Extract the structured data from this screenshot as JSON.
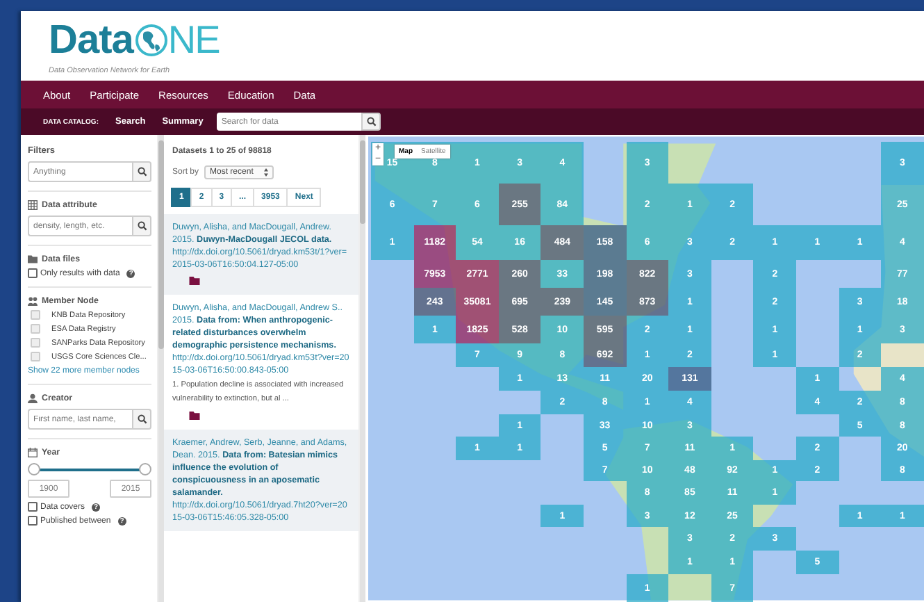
{
  "logo": {
    "word": "Data",
    "tail": "NE",
    "tagline": "Data Observation Network for Earth"
  },
  "nav": [
    "About",
    "Participate",
    "Resources",
    "Education",
    "Data"
  ],
  "catalog_bar": {
    "label": "DATA CATALOG:",
    "links": [
      "Search",
      "Summary"
    ],
    "search": {
      "placeholder": "Search for data"
    }
  },
  "filters": {
    "title": "Filters",
    "search": {
      "placeholder": "Anything"
    },
    "sections": [
      {
        "kind": "field",
        "title": "Data attribute",
        "placeholder": "density, length, etc."
      },
      {
        "kind": "checks",
        "title": "Data files",
        "items": [
          {
            "label": "Only results with data",
            "checked": false,
            "help": "?"
          }
        ]
      },
      {
        "kind": "checks",
        "title": "Member Node",
        "items": [
          {
            "label": "KNB Data Repository",
            "checked": false
          },
          {
            "label": "ESA Data Registry",
            "checked": false
          },
          {
            "label": "SANParks Data Repository",
            "checked": false
          },
          {
            "label": "USGS Core Sciences Cle...",
            "checked": false
          }
        ],
        "more": "Show 22 more member nodes"
      },
      {
        "kind": "field",
        "title": "Creator",
        "placeholder": "First name, last name,"
      },
      {
        "kind": "range",
        "title": "Year",
        "handles": [
          {
            "level": 0
          },
          {
            "level": 1
          }
        ],
        "low": "1900",
        "high": "2015",
        "items": [
          {
            "label": "Data covers",
            "checked": false,
            "help": "?"
          },
          {
            "label": "Published between",
            "checked": false,
            "help": "?"
          }
        ]
      }
    ]
  },
  "results": {
    "summary": "Datasets 1 to 25 of 98818",
    "sort": {
      "label": "Sort by",
      "value": "Most recent"
    },
    "pages": [
      {
        "label": "1",
        "selected": true
      },
      {
        "label": "2",
        "selected": false
      },
      {
        "label": "3",
        "selected": false
      },
      {
        "label": "...",
        "selected": false
      },
      {
        "label": "3953",
        "selected": false
      },
      {
        "label": "Next",
        "selected": false
      }
    ],
    "items": [
      {
        "citation": "Duwyn, Alisha, and MacDougall, Andrew. 2015. **Duwyn-MacDougall JECOL data.**",
        "url": "http://dx.doi.org/10.5061/dryad.km53t/1?ver=2015-03-06T16:50:04.127-05:00",
        "files": true
      },
      {
        "citation": "Duwyn, Alisha, and MacDougall, Andrew S.. 2015. **Data from: When anthropogenic-related disturbances overwhelm demographic persistence mechanisms.**",
        "url": "http://dx.doi.org/10.5061/dryad.km53t?ver=2015-03-06T16:50:00.843-05:00",
        "abstract": "1. Population decline is associated with increased vulnerability to extinction, but al ...",
        "files": true
      },
      {
        "citation": "Kraemer, Andrew, Serb, Jeanne, and Adams, Dean. 2015. **Data from: Batesian mimics influence the evolution of conspicuousness in an aposematic salamander.**",
        "url": "http://dx.doi.org/10.5061/dryad.7ht20?ver=2015-03-06T15:46:05.328-05:00",
        "files": false
      }
    ]
  },
  "map": {
    "zoom": {
      "in": "+",
      "out": "−"
    },
    "types": [
      {
        "label": "Map",
        "selected": true
      },
      {
        "label": "Satellite",
        "selected": false
      }
    ],
    "grid": [
      [
        {
          "kind": "count",
          "label": "15"
        },
        {
          "kind": "count",
          "label": "8"
        },
        {
          "kind": "count",
          "label": "1"
        },
        {
          "kind": "count",
          "label": "3"
        },
        {
          "kind": "count",
          "label": "4"
        },
        {
          "kind": "empty"
        },
        {
          "kind": "count",
          "label": "3"
        },
        {
          "kind": "empty"
        },
        {
          "kind": "empty"
        },
        {
          "kind": "empty"
        },
        {
          "kind": "empty"
        },
        {
          "kind": "empty"
        },
        {
          "kind": "count",
          "label": "3"
        }
      ],
      [
        {
          "kind": "count",
          "label": "6"
        },
        {
          "kind": "count",
          "label": "7"
        },
        {
          "kind": "count",
          "label": "6"
        },
        {
          "kind": "count",
          "label": "255"
        },
        {
          "kind": "count",
          "label": "84"
        },
        {
          "kind": "empty"
        },
        {
          "kind": "count",
          "label": "2"
        },
        {
          "kind": "count",
          "label": "1"
        },
        {
          "kind": "count",
          "label": "2"
        },
        {
          "kind": "empty"
        },
        {
          "kind": "empty"
        },
        {
          "kind": "empty"
        },
        {
          "kind": "count",
          "label": "25"
        }
      ],
      [
        {
          "kind": "count",
          "label": "1"
        },
        {
          "kind": "count",
          "label": "1182"
        },
        {
          "kind": "count",
          "label": "54"
        },
        {
          "kind": "count",
          "label": "16"
        },
        {
          "kind": "count",
          "label": "484"
        },
        {
          "kind": "count",
          "label": "158"
        },
        {
          "kind": "count",
          "label": "6"
        },
        {
          "kind": "count",
          "label": "3"
        },
        {
          "kind": "count",
          "label": "2"
        },
        {
          "kind": "count",
          "label": "1"
        },
        {
          "kind": "count",
          "label": "1"
        },
        {
          "kind": "count",
          "label": "1"
        },
        {
          "kind": "count",
          "label": "4"
        }
      ],
      [
        {
          "kind": "empty"
        },
        {
          "kind": "count",
          "label": "7953"
        },
        {
          "kind": "count",
          "label": "2771"
        },
        {
          "kind": "count",
          "label": "260"
        },
        {
          "kind": "count",
          "label": "33"
        },
        {
          "kind": "count",
          "label": "198"
        },
        {
          "kind": "count",
          "label": "822"
        },
        {
          "kind": "count",
          "label": "3"
        },
        {
          "kind": "empty"
        },
        {
          "kind": "count",
          "label": "2"
        },
        {
          "kind": "empty"
        },
        {
          "kind": "empty"
        },
        {
          "kind": "count",
          "label": "77"
        }
      ],
      [
        {
          "kind": "empty"
        },
        {
          "kind": "count",
          "label": "243"
        },
        {
          "kind": "count",
          "label": "35081"
        },
        {
          "kind": "count",
          "label": "695"
        },
        {
          "kind": "count",
          "label": "239"
        },
        {
          "kind": "count",
          "label": "145"
        },
        {
          "kind": "count",
          "label": "873"
        },
        {
          "kind": "count",
          "label": "1"
        },
        {
          "kind": "empty"
        },
        {
          "kind": "count",
          "label": "2"
        },
        {
          "kind": "empty"
        },
        {
          "kind": "count",
          "label": "3"
        },
        {
          "kind": "count",
          "label": "18"
        }
      ],
      [
        {
          "kind": "empty"
        },
        {
          "kind": "count",
          "label": "1"
        },
        {
          "kind": "count",
          "label": "1825"
        },
        {
          "kind": "count",
          "label": "528"
        },
        {
          "kind": "count",
          "label": "10"
        },
        {
          "kind": "count",
          "label": "595"
        },
        {
          "kind": "count",
          "label": "2"
        },
        {
          "kind": "count",
          "label": "1"
        },
        {
          "kind": "empty"
        },
        {
          "kind": "count",
          "label": "1"
        },
        {
          "kind": "empty"
        },
        {
          "kind": "count",
          "label": "1"
        },
        {
          "kind": "count",
          "label": "3"
        }
      ],
      [
        {
          "kind": "empty"
        },
        {
          "kind": "empty"
        },
        {
          "kind": "count",
          "label": "7"
        },
        {
          "kind": "count",
          "label": "9"
        },
        {
          "kind": "count",
          "label": "8"
        },
        {
          "kind": "count",
          "label": "692"
        },
        {
          "kind": "count",
          "label": "1"
        },
        {
          "kind": "count",
          "label": "2"
        },
        {
          "kind": "empty"
        },
        {
          "kind": "count",
          "label": "1"
        },
        {
          "kind": "empty"
        },
        {
          "kind": "count",
          "label": "2"
        },
        {
          "kind": "empty"
        }
      ],
      [
        {
          "kind": "empty"
        },
        {
          "kind": "empty"
        },
        {
          "kind": "empty"
        },
        {
          "kind": "count",
          "label": "1"
        },
        {
          "kind": "count",
          "label": "13"
        },
        {
          "kind": "count",
          "label": "11"
        },
        {
          "kind": "count",
          "label": "20"
        },
        {
          "kind": "count",
          "label": "131"
        },
        {
          "kind": "empty"
        },
        {
          "kind": "empty"
        },
        {
          "kind": "count",
          "label": "1"
        },
        {
          "kind": "empty"
        },
        {
          "kind": "count",
          "label": "4"
        }
      ],
      [
        {
          "kind": "empty"
        },
        {
          "kind": "empty"
        },
        {
          "kind": "empty"
        },
        {
          "kind": "empty"
        },
        {
          "kind": "count",
          "label": "2"
        },
        {
          "kind": "count",
          "label": "8"
        },
        {
          "kind": "count",
          "label": "1"
        },
        {
          "kind": "count",
          "label": "4"
        },
        {
          "kind": "empty"
        },
        {
          "kind": "empty"
        },
        {
          "kind": "count",
          "label": "4"
        },
        {
          "kind": "count",
          "label": "2"
        },
        {
          "kind": "count",
          "label": "8"
        }
      ],
      [
        {
          "kind": "empty"
        },
        {
          "kind": "empty"
        },
        {
          "kind": "empty"
        },
        {
          "kind": "count",
          "label": "1"
        },
        {
          "kind": "empty"
        },
        {
          "kind": "count",
          "label": "33"
        },
        {
          "kind": "count",
          "label": "10"
        },
        {
          "kind": "count",
          "label": "3"
        },
        {
          "kind": "empty"
        },
        {
          "kind": "empty"
        },
        {
          "kind": "empty"
        },
        {
          "kind": "count",
          "label": "5"
        },
        {
          "kind": "count",
          "label": "8"
        }
      ],
      [
        {
          "kind": "empty"
        },
        {
          "kind": "empty"
        },
        {
          "kind": "count",
          "label": "1"
        },
        {
          "kind": "count",
          "label": "1"
        },
        {
          "kind": "empty"
        },
        {
          "kind": "count",
          "label": "5"
        },
        {
          "kind": "count",
          "label": "7"
        },
        {
          "kind": "count",
          "label": "11"
        },
        {
          "kind": "count",
          "label": "1"
        },
        {
          "kind": "empty"
        },
        {
          "kind": "count",
          "label": "2"
        },
        {
          "kind": "empty"
        },
        {
          "kind": "count",
          "label": "20"
        }
      ],
      [
        {
          "kind": "empty"
        },
        {
          "kind": "empty"
        },
        {
          "kind": "empty"
        },
        {
          "kind": "empty"
        },
        {
          "kind": "empty"
        },
        {
          "kind": "count",
          "label": "7"
        },
        {
          "kind": "count",
          "label": "10"
        },
        {
          "kind": "count",
          "label": "48"
        },
        {
          "kind": "count",
          "label": "92"
        },
        {
          "kind": "count",
          "label": "1"
        },
        {
          "kind": "count",
          "label": "2"
        },
        {
          "kind": "empty"
        },
        {
          "kind": "count",
          "label": "8"
        }
      ],
      [
        {
          "kind": "empty"
        },
        {
          "kind": "empty"
        },
        {
          "kind": "empty"
        },
        {
          "kind": "empty"
        },
        {
          "kind": "empty"
        },
        {
          "kind": "empty"
        },
        {
          "kind": "count",
          "label": "8"
        },
        {
          "kind": "count",
          "label": "85"
        },
        {
          "kind": "count",
          "label": "11"
        },
        {
          "kind": "count",
          "label": "1"
        },
        {
          "kind": "empty"
        },
        {
          "kind": "empty"
        },
        {
          "kind": "empty"
        }
      ],
      [
        {
          "kind": "empty"
        },
        {
          "kind": "empty"
        },
        {
          "kind": "empty"
        },
        {
          "kind": "empty"
        },
        {
          "kind": "count",
          "label": "1"
        },
        {
          "kind": "empty"
        },
        {
          "kind": "count",
          "label": "3"
        },
        {
          "kind": "count",
          "label": "12"
        },
        {
          "kind": "count",
          "label": "25"
        },
        {
          "kind": "empty"
        },
        {
          "kind": "empty"
        },
        {
          "kind": "count",
          "label": "1"
        },
        {
          "kind": "count",
          "label": "1"
        }
      ],
      [
        {
          "kind": "empty"
        },
        {
          "kind": "empty"
        },
        {
          "kind": "empty"
        },
        {
          "kind": "empty"
        },
        {
          "kind": "empty"
        },
        {
          "kind": "empty"
        },
        {
          "kind": "empty"
        },
        {
          "kind": "count",
          "label": "3"
        },
        {
          "kind": "count",
          "label": "2"
        },
        {
          "kind": "count",
          "label": "3"
        },
        {
          "kind": "empty"
        },
        {
          "kind": "empty"
        },
        {
          "kind": "empty"
        }
      ],
      [
        {
          "kind": "empty"
        },
        {
          "kind": "empty"
        },
        {
          "kind": "empty"
        },
        {
          "kind": "empty"
        },
        {
          "kind": "empty"
        },
        {
          "kind": "empty"
        },
        {
          "kind": "empty"
        },
        {
          "kind": "count",
          "label": "1"
        },
        {
          "kind": "count",
          "label": "1"
        },
        {
          "kind": "empty"
        },
        {
          "kind": "count",
          "label": "5"
        },
        {
          "kind": "empty"
        },
        {
          "kind": "empty"
        }
      ],
      [
        {
          "kind": "empty"
        },
        {
          "kind": "empty"
        },
        {
          "kind": "empty"
        },
        {
          "kind": "empty"
        },
        {
          "kind": "empty"
        },
        {
          "kind": "empty"
        },
        {
          "kind": "count",
          "label": "1"
        },
        {
          "kind": "empty"
        },
        {
          "kind": "count",
          "label": "7"
        },
        {
          "kind": "empty"
        },
        {
          "kind": "empty"
        },
        {
          "kind": "empty"
        },
        {
          "kind": "empty"
        }
      ]
    ]
  }
}
